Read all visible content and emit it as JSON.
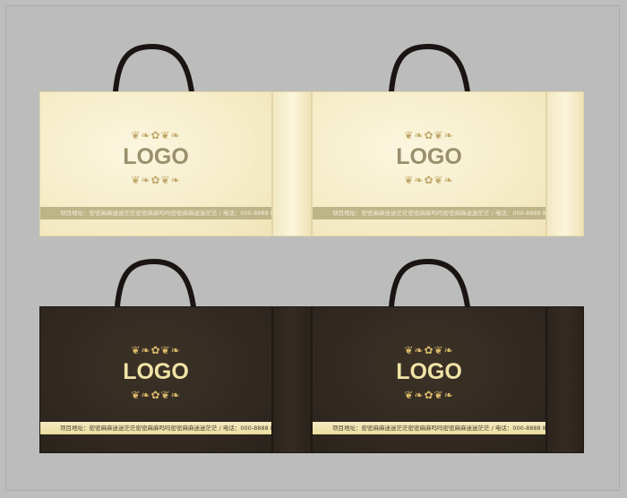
{
  "bags": [
    {
      "id": "light",
      "logo": "LOGO",
      "address_line": "项目地址：密密麻麻迷迷茫茫密密麻麻吗吗密密麻麻迷迷茫茫 / 电话：000-8888 8888"
    },
    {
      "id": "dark",
      "logo": "LOGO",
      "address_line": "项目地址：密密麻麻迷迷茫茫密密麻麻吗吗密密麻麻迷迷茫茫 / 电话：000-8888 8888"
    }
  ],
  "ornament": "❦❧✿❦❧",
  "colors": {
    "background": "#bdbdbd",
    "light_bag": "#f5ecc8",
    "dark_bag": "#302821",
    "handle": "#1a1512"
  }
}
